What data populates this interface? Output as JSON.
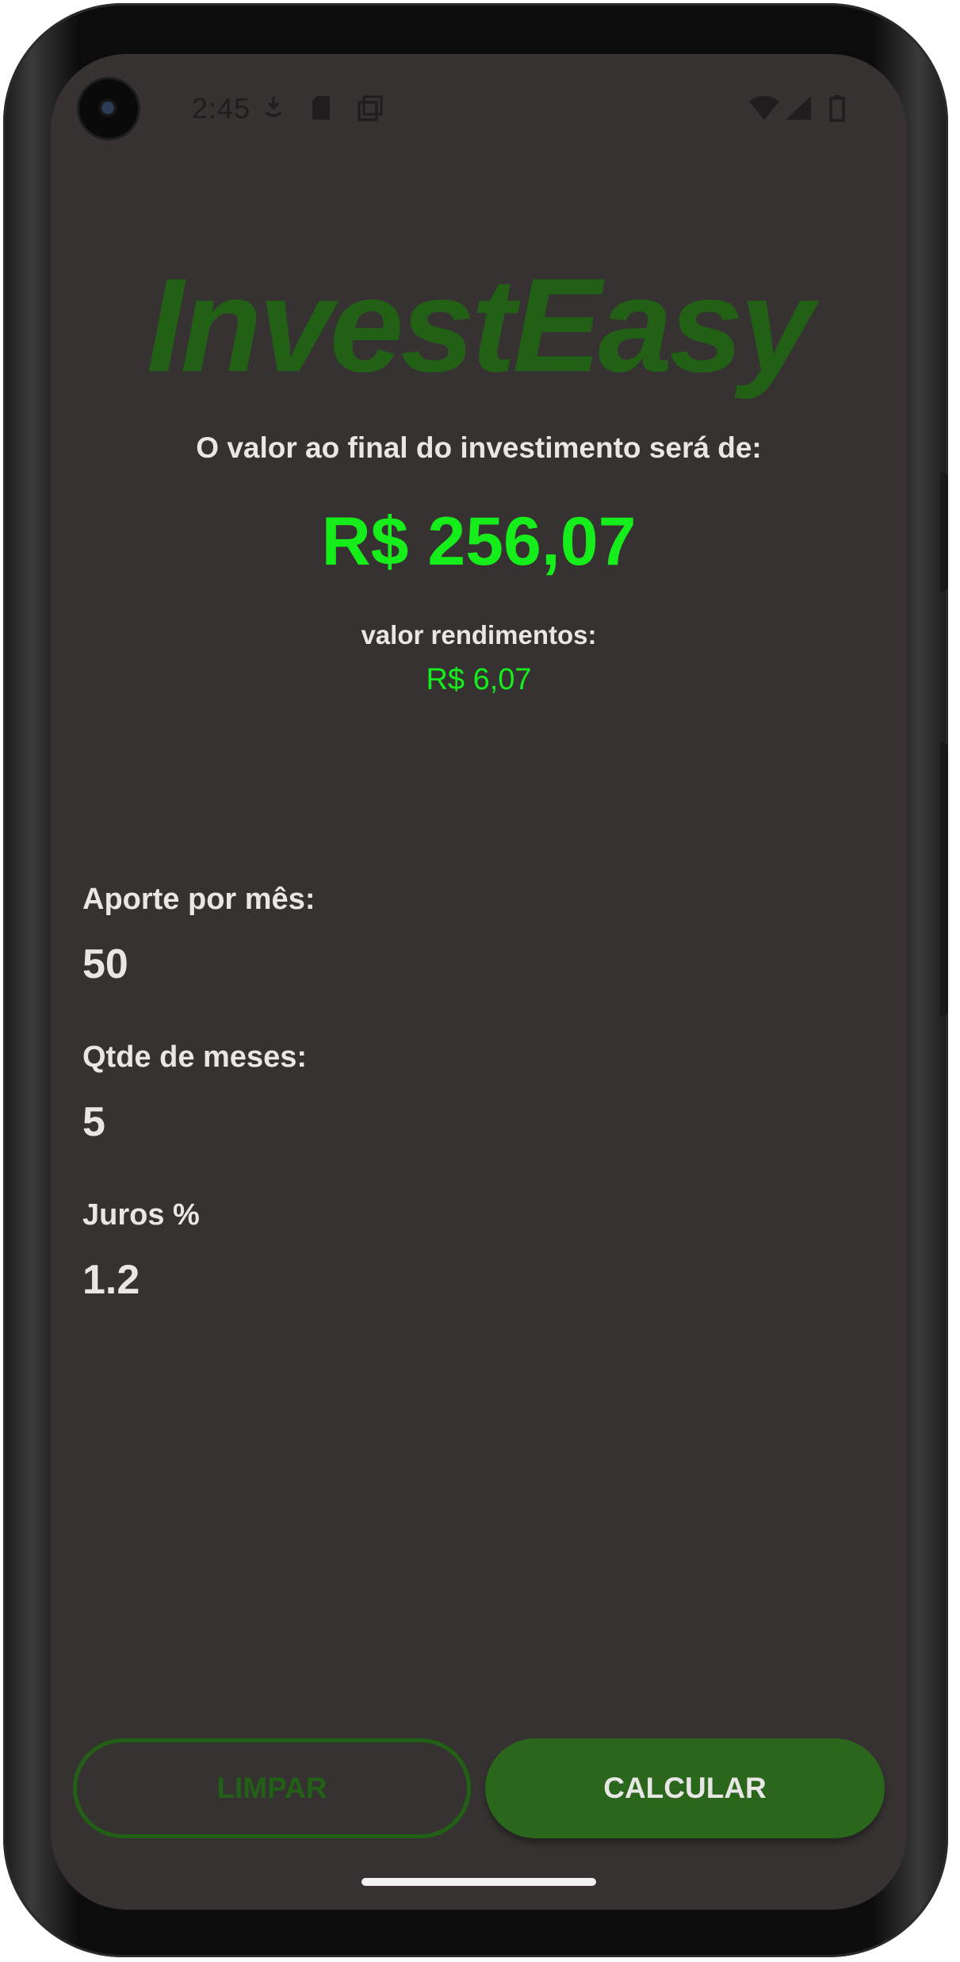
{
  "status_bar": {
    "time": "2:45",
    "icons": [
      "download-icon",
      "sd-card-icon",
      "screenshot-icon",
      "wifi-icon",
      "cell-signal-icon",
      "battery-icon"
    ]
  },
  "app": {
    "title": "InvestEasy"
  },
  "result": {
    "heading": "O valor ao final do investimento será de:",
    "final_value": "R$ 256,07",
    "yield_label": "valor rendimentos:",
    "yield_value": "R$ 6,07"
  },
  "form": {
    "monthly_label": "Aporte por mês:",
    "monthly_value": "50",
    "months_label": "Qtde de meses:",
    "months_value": "5",
    "interest_label": "Juros %",
    "interest_value": "1.2"
  },
  "buttons": {
    "clear_label": "LIMPAR",
    "calculate_label": "CALCULAR"
  },
  "colors": {
    "background": "#363232",
    "brand_green": "#226016",
    "result_green": "#16ee1c",
    "text_light": "#e9e6e6",
    "button_green": "#2a661b"
  }
}
